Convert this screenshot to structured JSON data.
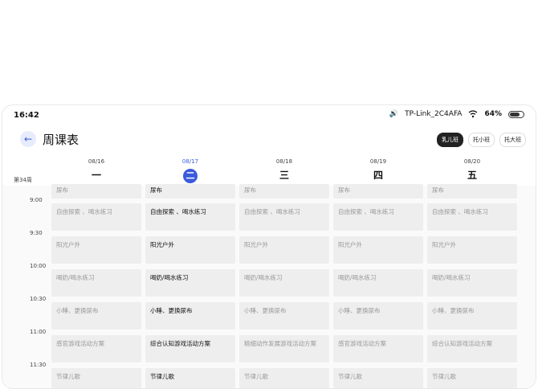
{
  "status": {
    "time": "16:42",
    "wifi_name": "TP-Link_2C4AFA",
    "battery": "64%",
    "volume_icon": "vibrate-icon"
  },
  "header": {
    "title": "周课表",
    "back_icon": "back-arrow-icon",
    "classes": [
      {
        "label": "乳儿班",
        "active": true
      },
      {
        "label": "托小班",
        "active": false
      },
      {
        "label": "托大班",
        "active": false
      }
    ]
  },
  "week_label": "第34周",
  "days": [
    {
      "date": "08/16",
      "weekday": "一"
    },
    {
      "date": "08/17",
      "weekday": "二"
    },
    {
      "date": "08/18",
      "weekday": "三"
    },
    {
      "date": "08/19",
      "weekday": "四"
    },
    {
      "date": "08/20",
      "weekday": "五"
    }
  ],
  "times": [
    "9:00",
    "9:30",
    "10:00",
    "10:30",
    "11:00",
    "11:30"
  ],
  "rows": [
    [
      "尿布",
      "尿布",
      "尿布",
      "尿布",
      "尿布"
    ],
    [
      "自由探索 、喝水练习",
      "自由探索 、喝水练习",
      "自由探索 、喝水练习",
      "自由探索 、喝水练习",
      "自由探索 、喝水练习"
    ],
    [
      "阳光户外",
      "阳光户外",
      "阳光户外",
      "阳光户外",
      "阳光户外"
    ],
    [
      "喝奶/喝水练习",
      "喝奶/喝水练习",
      "喝奶/喝水练习",
      "喝奶/喝水练习",
      "喝奶/喝水练习"
    ],
    [
      "小睡、更换尿布",
      "小睡、更换尿布",
      "小睡、更换尿布",
      "小睡、更换尿布",
      "小睡、更换尿布"
    ],
    [
      "感官游戏活动方案",
      "综合认知游戏活动方案",
      "精细动作发展游戏活动方案",
      "感官游戏活动方案",
      "综合认知游戏活动方案"
    ],
    [
      "节律儿歌",
      "节律儿歌",
      "节律儿歌",
      "节律儿歌",
      "节律儿歌"
    ]
  ]
}
